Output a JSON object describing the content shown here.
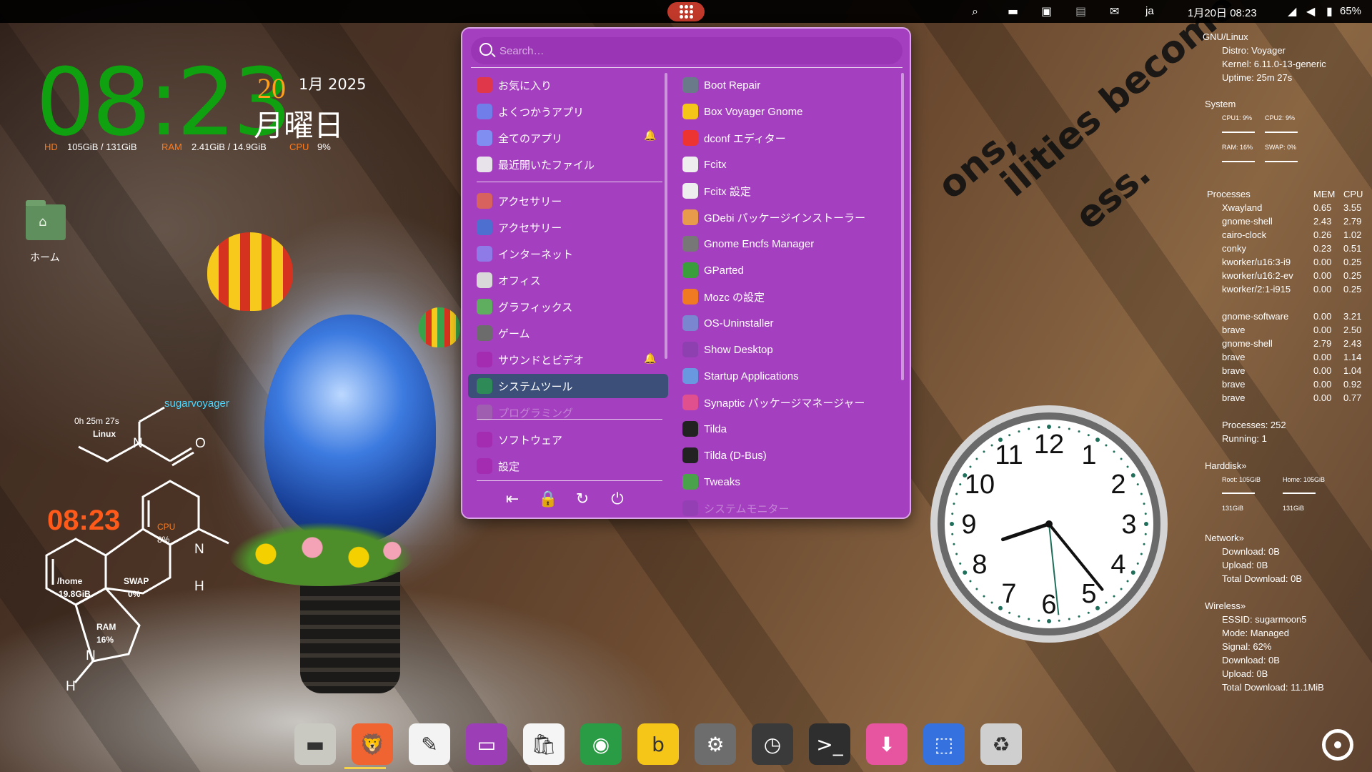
{
  "topbar": {
    "activities_label": "Activities",
    "icons": [
      "search-icon",
      "window-icon",
      "dashboard-icon",
      "clipboard-icon",
      "mail-icon"
    ],
    "lang": "ja",
    "datetime": "1月20日  08:23",
    "wifi_icon": "wifi-icon",
    "volume_icon": "volume-icon",
    "battery": "65%"
  },
  "conky_clock": {
    "time": "08:23",
    "day": "20",
    "month_year": "1月 2025",
    "weekday": "月曜日",
    "hd_label": "HD",
    "hd_value": "105GiB / 131GiB",
    "ram_label": "RAM",
    "ram_value": "2.41GiB / 14.9GiB",
    "cpu_label": "CPU",
    "cpu_value": "9%"
  },
  "desktop": {
    "home_label": "ホーム",
    "wallpaper_text": [
      "ons,",
      "ilities become",
      "ess."
    ]
  },
  "molecule": {
    "user": "sugarvoyager",
    "uptime": "0h 25m 27s",
    "os": "Linux",
    "time": "08:23",
    "o": "O",
    "n1": "N",
    "n2": "N",
    "n3": "N",
    "h1": "H",
    "h2": "H",
    "cpu_label": "CPU",
    "cpu_value": "8%",
    "home_label": "/home",
    "home_value": "19.8GiB",
    "swap_label": "SWAP",
    "swap_value": "0%",
    "ram_label": "RAM",
    "ram_value": "16%"
  },
  "menu": {
    "search_placeholder": "Search…",
    "categories": [
      {
        "label": "お気に入り",
        "icon": "heart-icon"
      },
      {
        "label": "よくつかうアプリ",
        "icon": "frequent-icon"
      },
      {
        "label": "全てのアプリ",
        "icon": "grid-icon"
      },
      {
        "label": "最近開いたファイル",
        "icon": "clock-icon"
      },
      {
        "label": "アクセサリー",
        "icon": "tools-icon"
      },
      {
        "label": "アクセサリー",
        "icon": "accessories-icon"
      },
      {
        "label": "インターネット",
        "icon": "globe-icon"
      },
      {
        "label": "オフィス",
        "icon": "office-icon"
      },
      {
        "label": "グラフィックス",
        "icon": "graphics-icon"
      },
      {
        "label": "ゲーム",
        "icon": "gamepad-icon"
      },
      {
        "label": "サウンドとビデオ",
        "icon": "media-icon"
      },
      {
        "label": "システムツール",
        "icon": "system-tools-icon"
      },
      {
        "label": "プログラミング",
        "icon": "programming-icon"
      },
      {
        "label": "ソフトウェア",
        "icon": "software-icon"
      },
      {
        "label": "設定",
        "icon": "settings-icon"
      }
    ],
    "apps": [
      {
        "label": "Boot Repair",
        "icon": "boot-repair-icon"
      },
      {
        "label": "Box Voyager Gnome",
        "icon": "box-voyager-icon"
      },
      {
        "label": "dconf エディター",
        "icon": "dconf-icon"
      },
      {
        "label": "Fcitx",
        "icon": "penguin-icon"
      },
      {
        "label": "Fcitx 設定",
        "icon": "penguin-icon"
      },
      {
        "label": "GDebi パッケージインストーラー",
        "icon": "gdebi-icon"
      },
      {
        "label": "Gnome Encfs Manager",
        "icon": "encfs-icon"
      },
      {
        "label": "GParted",
        "icon": "gparted-icon"
      },
      {
        "label": "Mozc の設定",
        "icon": "mozc-icon"
      },
      {
        "label": "OS-Uninstaller",
        "icon": "uninstaller-icon"
      },
      {
        "label": "Show Desktop",
        "icon": "desktop-icon"
      },
      {
        "label": "Startup Applications",
        "icon": "startup-icon"
      },
      {
        "label": "Synaptic パッケージマネージャー",
        "icon": "synaptic-icon"
      },
      {
        "label": "Tilda",
        "icon": "terminal-icon"
      },
      {
        "label": "Tilda (D-Bus)",
        "icon": "terminal-icon"
      },
      {
        "label": "Tweaks",
        "icon": "tweaks-icon"
      },
      {
        "label": "システムモニター",
        "icon": "monitor-icon"
      }
    ],
    "power": [
      "logout-icon",
      "lock-icon",
      "restart-icon",
      "power-icon"
    ]
  },
  "conky_right": {
    "gnu_linux": "GNU/Linux",
    "distro": "Distro: Voyager",
    "kernel": "Kernel: 6.11.0-13-generic",
    "uptime": "Uptime: 25m 27s",
    "system": "System",
    "cpu1": "CPU1: 9%",
    "cpu2": "CPU2: 9%",
    "ram": "RAM: 16%",
    "swap": "SWAP: 0%",
    "processes_hdr": "Processes",
    "mem_hdr": "MEM",
    "cpu_hdr": "CPU",
    "procs": [
      {
        "n": "Xwayland",
        "m": "0.65",
        "c": "3.55"
      },
      {
        "n": "gnome-shell",
        "m": "2.43",
        "c": "2.79"
      },
      {
        "n": "cairo-clock",
        "m": "0.26",
        "c": "1.02"
      },
      {
        "n": "conky",
        "m": "0.23",
        "c": "0.51"
      },
      {
        "n": "kworker/u16:3-i9",
        "m": "0.00",
        "c": "0.25"
      },
      {
        "n": "kworker/u16:2-ev",
        "m": "0.00",
        "c": "0.25"
      },
      {
        "n": "kworker/2:1-i915",
        "m": "0.00",
        "c": "0.25"
      }
    ],
    "procs2": [
      {
        "n": "gnome-software",
        "m": "0.00",
        "c": "3.21"
      },
      {
        "n": "brave",
        "m": "0.00",
        "c": "2.50"
      },
      {
        "n": "gnome-shell",
        "m": "2.79",
        "c": "2.43"
      },
      {
        "n": "brave",
        "m": "0.00",
        "c": "1.14"
      },
      {
        "n": "brave",
        "m": "0.00",
        "c": "1.04"
      },
      {
        "n": "brave",
        "m": "0.00",
        "c": "0.92"
      },
      {
        "n": "brave",
        "m": "0.00",
        "c": "0.77"
      }
    ],
    "processes_total": "Processes: 252",
    "running": "Running: 1",
    "harddisk": "Harddisk»",
    "root": "Root: 105GiB",
    "home": "Home: 105GiB",
    "root_total": "131GiB",
    "home_total": "131GiB",
    "network": "Network»",
    "download": "Download: 0B",
    "upload": "Upload: 0B",
    "total_download": "Total Download: 0B",
    "wireless": "Wireless»",
    "essid": "ESSID: sugarmoon5",
    "mode": "Mode: Managed",
    "signal": "Signal: 62%",
    "w_download": "Download: 0B",
    "w_upload": "Upload: 0B",
    "w_total": "Total Download: 11.1MiB"
  },
  "analog_clock": {
    "numbers": [
      "12",
      "1",
      "2",
      "3",
      "4",
      "5",
      "6",
      "7",
      "8",
      "9",
      "10",
      "11"
    ],
    "hour": 8,
    "minute": 23,
    "second": 29
  },
  "dock": [
    {
      "name": "files-app",
      "icon": "folder-icon",
      "color": "#c9c9c2"
    },
    {
      "name": "brave-browser",
      "icon": "brave-icon",
      "color": "#f06432"
    },
    {
      "name": "text-editor",
      "icon": "notepad-icon",
      "color": "#f3f3f3"
    },
    {
      "name": "box-voyager",
      "icon": "terminal-window-icon",
      "color": "#9c3fb6"
    },
    {
      "name": "software-center",
      "icon": "store-icon",
      "color": "#f5f5f5"
    },
    {
      "name": "chrome-browser",
      "icon": "chrome-icon",
      "color": "#2a9c45"
    },
    {
      "name": "bonjour-app",
      "icon": "b-icon",
      "color": "#f5c518"
    },
    {
      "name": "settings-app",
      "icon": "gear-icon",
      "color": "#6d6d6d"
    },
    {
      "name": "clock-app",
      "icon": "clock-icon",
      "color": "#3a3a3a"
    },
    {
      "name": "terminal-app",
      "icon": "terminal-icon",
      "color": "#2e2e2e"
    },
    {
      "name": "installer-app",
      "icon": "install-icon",
      "color": "#e754a0"
    },
    {
      "name": "screenshot-app",
      "icon": "screenshot-icon",
      "color": "#3572e0"
    },
    {
      "name": "trash",
      "icon": "trash-icon",
      "color": "#cfcfcf"
    }
  ],
  "show_apps_icon": "ubuntu-icon"
}
